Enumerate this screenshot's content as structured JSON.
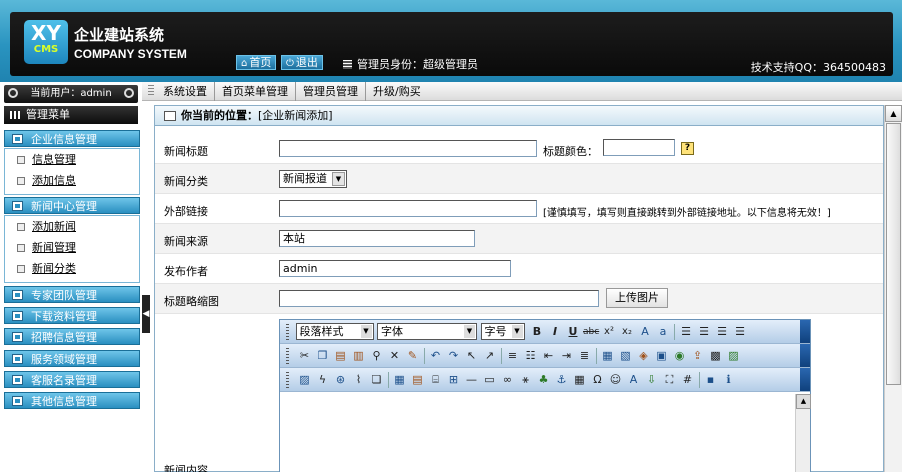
{
  "header": {
    "logo_xy": "XY",
    "logo_cms": "CMS",
    "title": "企业建站系统",
    "subtitle": "COMPANY SYSTEM",
    "home_label": "首页",
    "logout_label": "退出",
    "role_text": "管理员身份：超级管理员",
    "support_text": "技术支持QQ：364500483"
  },
  "navbar": {
    "items": [
      "系统设置",
      "首页菜单管理",
      "管理员管理",
      "升级/购买"
    ]
  },
  "sidebar": {
    "current_user": "当前用户：admin",
    "menu_title": "管理菜单",
    "groups": [
      {
        "label": "企业信息管理",
        "items": [
          "信息管理",
          "添加信息"
        ]
      },
      {
        "label": "新闻中心管理",
        "items": [
          "添加新闻",
          "新闻管理",
          "新闻分类"
        ]
      },
      {
        "label": "专家团队管理"
      },
      {
        "label": "下载资料管理"
      },
      {
        "label": "招聘信息管理"
      },
      {
        "label": "服务领域管理"
      },
      {
        "label": "客服名录管理"
      },
      {
        "label": "其他信息管理"
      }
    ]
  },
  "main": {
    "position_label": "你当前的位置：",
    "position_value": "[企业新闻添加]",
    "fields": {
      "title_label": "新闻标题",
      "title_color_label": "标题颜色：",
      "help_icon": "?",
      "category_label": "新闻分类",
      "category_value": "新闻报道",
      "link_label": "外部链接",
      "link_note": "[谨慎填写，填写则直接跳转到外部链接地址。以下信息将无效！]",
      "source_label": "新闻来源",
      "source_value": "本站",
      "author_label": "发布作者",
      "author_value": "admin",
      "thumb_label": "标题略缩图",
      "upload_label": "上传图片",
      "content_label": "新闻内容"
    },
    "editor": {
      "paragraph_style": "段落样式",
      "font": "字体",
      "font_size": "字号"
    }
  }
}
